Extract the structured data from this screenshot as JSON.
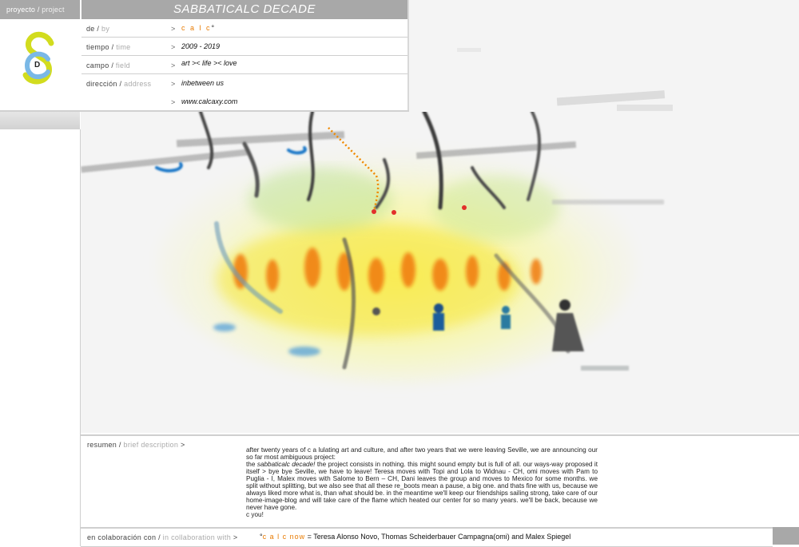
{
  "left_tab": {
    "es": "proyecto",
    "sep": " / ",
    "en": "project"
  },
  "title": "SABBATICALC DECADE",
  "logo": {
    "letters": "S C D",
    "colors": {
      "yellow": "#d2dc1e",
      "blue": "#7ab8e6",
      "letter": "#222222"
    }
  },
  "info": {
    "by": {
      "es": "de",
      "en": "by",
      "arrow": ">",
      "value": "c a l c",
      "mark": "°"
    },
    "time": {
      "es": "tiempo",
      "en": "time",
      "arrow": ">",
      "value": "2009 - 2019"
    },
    "field": {
      "es": "campo",
      "en": "field",
      "arrow": ">",
      "value": "art >< life >< love"
    },
    "address": {
      "es": "dirección",
      "en": "address",
      "arrow": ">",
      "value": "inbetween us"
    },
    "link": {
      "arrow": ">",
      "value": "www.calcaxy.com"
    },
    "sep": " / "
  },
  "description": {
    "es": "resumen",
    "en": "brief description",
    "arrow": ">",
    "p1": "after twenty years of c a lulating art and culture, and after two years that we were leaving Seville, we are announcing our so far most ambiguous project:",
    "p2_pre": "the ",
    "p2_italic": "sabbaticalc decade!",
    "p2_post": " the project consists in nothing. this might sound empty but is full of all. our ways-way proposed it itself > bye bye Seville, we have to leave! Teresa moves with Topi and Lola to Widnau - CH, omi moves with Pam to Puglia - I, Malex moves with Salome to Bern – CH, Dani leaves the group and moves to Mexico for some months. we split without splitting, but we also see that all these re_boots mean a pause, a big one. and thats fine with us, because we always liked more what is, than what should be. in the meantime we'll keep our friendships sailing strong, take care of our home-image-blog and will take care of the flame which heated our center for so many years. we'll be back, because we never have gone.",
    "p3": "c you!"
  },
  "footer": {
    "es": "en colaboración con",
    "en": "in collaboration with",
    "arrow": ">",
    "mark": "°",
    "calc": "c a l c now",
    "members": " = Teresa Alonso Novo, Thomas Scheiderbauer Campagna(omi) and Malex Spiegel"
  },
  "colors": {
    "bar": "#a8a8a8",
    "accent": "#e87a00",
    "link": "#2a6ebb"
  }
}
